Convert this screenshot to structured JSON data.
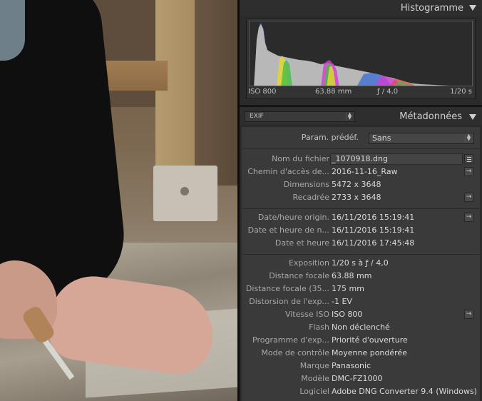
{
  "histogram": {
    "title": "Histogramme",
    "iso": "ISO 800",
    "focal": "63.88 mm",
    "aperture": "ƒ / 4,0",
    "shutter": "1/20 s"
  },
  "metadata": {
    "title": "Métadonnées",
    "view_select": "EXIF",
    "preset_label": "Param. prédéf.",
    "preset_value": "Sans",
    "groups": [
      [
        {
          "label": "Nom du fichier",
          "value": "_1070918.dng"
        },
        {
          "label": "Chemin d'accès de...",
          "value": "2016-11-16_Raw"
        },
        {
          "label": "Dimensions",
          "value": "5472 x 3648"
        },
        {
          "label": "Recadrée",
          "value": "2733 x 3648"
        }
      ],
      [
        {
          "label": "Date/heure origin.",
          "value": "16/11/2016 15:19:41"
        },
        {
          "label": "Date et heure de n...",
          "value": "16/11/2016 15:19:41"
        },
        {
          "label": "Date et heure",
          "value": "16/11/2016 17:45:48"
        }
      ],
      [
        {
          "label": "Exposition",
          "value": "1/20 s à ƒ / 4,0"
        },
        {
          "label": "Distance focale",
          "value": "63.88 mm"
        },
        {
          "label": "Distance focale (35...",
          "value": "175 mm"
        },
        {
          "label": "Distorsion de l'exp...",
          "value": "-1 EV"
        },
        {
          "label": "Vitesse ISO",
          "value": "ISO 800"
        },
        {
          "label": "Flash",
          "value": "Non déclenché"
        },
        {
          "label": "Programme d'exp...",
          "value": "Priorité d'ouverture"
        },
        {
          "label": "Mode de contrôle",
          "value": "Moyenne pondérée"
        },
        {
          "label": "Marque",
          "value": "Panasonic"
        },
        {
          "label": "Modèle",
          "value": "DMC-FZ1000"
        },
        {
          "label": "Logiciel",
          "value": "Adobe DNG Converter 9.4 (Windows)"
        }
      ]
    ]
  }
}
